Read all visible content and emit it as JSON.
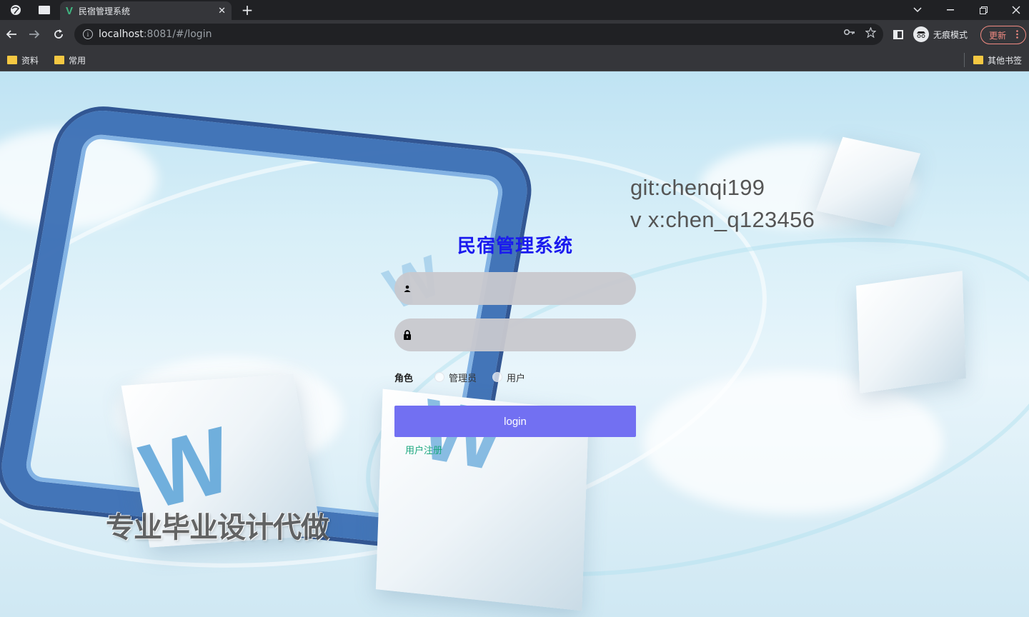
{
  "browser": {
    "tab_title": "民宿管理系统",
    "tab_logo": "V",
    "tab_close": "✕",
    "new_tab": "+",
    "url_host": "localhost",
    "url_path": ":8081/#/login",
    "incognito_label": "无痕模式",
    "update_label": "更新",
    "bookmarks": [
      "资料",
      "常用"
    ],
    "other_bookmarks": "其他书签"
  },
  "background_text": {
    "contact_line1": "git:chenqi199",
    "contact_line2": "v x:chen_q123456",
    "watermark": "专业毕业设计代做"
  },
  "login": {
    "title": "民宿管理系统",
    "username_value": "",
    "password_value": "",
    "role_label": "角色",
    "roles": [
      "管理员",
      "用户"
    ],
    "selected_role": null,
    "submit_label": "login",
    "register_link": "用户注册"
  },
  "colors": {
    "title": "#1a1aee",
    "button": "#7270f2",
    "register_link": "#1aa77e"
  }
}
